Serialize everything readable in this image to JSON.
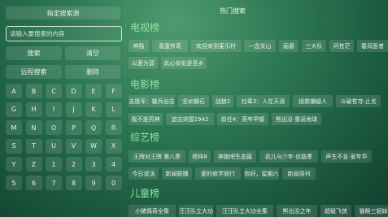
{
  "left": {
    "title": "指定搜索源",
    "search_placeholder": "请输入要搜索的内容",
    "search_label": "搜索",
    "clear_label": "清空",
    "remote_label": "远程搜索",
    "delete_label": "删除",
    "keys": [
      "A",
      "B",
      "C",
      "D",
      "E",
      "F",
      "G",
      "H",
      "I",
      "J",
      "K",
      "L",
      "M",
      "N",
      "O",
      "P",
      "Q",
      "R",
      "S",
      "T",
      "U",
      "V",
      "W",
      "X",
      "Y",
      "Z",
      "1",
      "2",
      "3",
      "4",
      "5",
      "6",
      "7",
      "8",
      "9",
      "0"
    ]
  },
  "right": {
    "title": "热门搜索",
    "sections": [
      {
        "heading": "电视榜",
        "rows": [
          [
            "神隐",
            "喜蛋传奇",
            "欢迎来到麦乐村",
            "一念关山",
            "画眉",
            "三大队",
            "问苍茫",
            "春风医者"
          ],
          [
            "以爱为营",
            "此心安处是吾乡"
          ]
        ]
      },
      {
        "heading": "电影榜",
        "rows": [
          [
            "志愿军：雄兵出击",
            "坚如磐石",
            "战狼2",
            "扫毒3：人在天涯",
            "拯救嫌疑人",
            "斗破苍穹·止戈"
          ],
          [
            "我不是药神",
            "追击突围1942",
            "前任4：英年早婚",
            "熊出没·重返地球"
          ]
        ]
      },
      {
        "heading": "综艺榜",
        "rows": [
          [
            "王牌对王牌 第八季",
            "榜样8",
            "奔跑吧生态篇",
            "花儿与少年·丝路季",
            "声生不息·家年华"
          ],
          [
            "今日说法",
            "新闻联播",
            "爱的修学旅行",
            "你好，星期六",
            "新闻周刊"
          ]
        ]
      },
      {
        "heading": "儿童榜",
        "rows": [
          [
            "小猪佩奇全集",
            "汪汪队立大功",
            "汪汪队立大功全集",
            "熊出没之年",
            "超级飞侠",
            "猫眼三姐妹"
          ]
        ]
      }
    ]
  }
}
